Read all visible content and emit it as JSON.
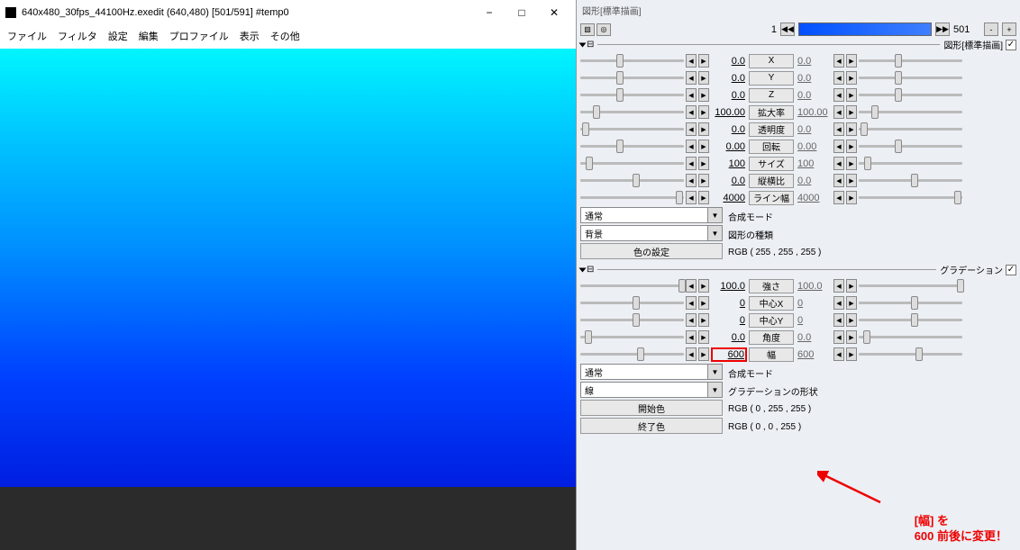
{
  "window": {
    "title": "640x480_30fps_44100Hz.exedit (640,480)  [501/591]  #temp0",
    "minimize": "−",
    "maximize": "□",
    "close": "✕"
  },
  "menu": {
    "file": "ファイル",
    "filter": "フィルタ",
    "settings": "設定",
    "edit": "編集",
    "profile": "プロファイル",
    "display": "表示",
    "other": "その他"
  },
  "panel": {
    "title": "図形[標準描画]"
  },
  "timeline": {
    "cur": "1",
    "end": "501",
    "minus": "-",
    "plus": "+"
  },
  "section1": {
    "name": "図形[標準描画]",
    "handle": "⊟",
    "params": [
      {
        "label": "X",
        "v1": "0.0",
        "v2": "0.0",
        "t1": 35,
        "t2": 35
      },
      {
        "label": "Y",
        "v1": "0.0",
        "v2": "0.0",
        "t1": 35,
        "t2": 35
      },
      {
        "label": "Z",
        "v1": "0.0",
        "v2": "0.0",
        "t1": 35,
        "t2": 35
      },
      {
        "label": "拡大率",
        "v1": "100.00",
        "v2": "100.00",
        "t1": 12,
        "t2": 12
      },
      {
        "label": "透明度",
        "v1": "0.0",
        "v2": "0.0",
        "t1": 2,
        "t2": 2
      },
      {
        "label": "回転",
        "v1": "0.00",
        "v2": "0.00",
        "t1": 35,
        "t2": 35
      },
      {
        "label": "サイズ",
        "v1": "100",
        "v2": "100",
        "t1": 5,
        "t2": 5
      },
      {
        "label": "縦横比",
        "v1": "0.0",
        "v2": "0.0",
        "t1": 50,
        "t2": 50
      },
      {
        "label": "ライン幅",
        "v1": "4000",
        "v2": "4000",
        "t1": 92,
        "t2": 92
      }
    ],
    "blend_mode": "通常",
    "blend_label": "合成モード",
    "shape_type": "背景",
    "shape_label": "図形の種類",
    "color_btn": "色の設定",
    "rgb": "RGB ( 255 , 255 , 255 )"
  },
  "section2": {
    "name": "グラデーション",
    "handle": "⊟",
    "params": [
      {
        "label": "強さ",
        "v1": "100.0",
        "v2": "100.0",
        "t1": 95,
        "t2": 95,
        "hl": false
      },
      {
        "label": "中心X",
        "v1": "0",
        "v2": "0",
        "t1": 50,
        "t2": 50,
        "hl": false
      },
      {
        "label": "中心Y",
        "v1": "0",
        "v2": "0",
        "t1": 50,
        "t2": 50,
        "hl": false
      },
      {
        "label": "角度",
        "v1": "0.0",
        "v2": "0.0",
        "t1": 4,
        "t2": 4,
        "hl": false
      },
      {
        "label": "幅",
        "v1": "600",
        "v2": "600",
        "t1": 55,
        "t2": 55,
        "hl": true
      }
    ],
    "blend_mode": "通常",
    "blend_label": "合成モード",
    "grad_shape": "線",
    "grad_label": "グラデーションの形状",
    "start_color": "開始色",
    "start_rgb": "RGB ( 0 , 255 , 255 )",
    "end_color": "終了色",
    "end_rgb": "RGB ( 0 , 0 , 255 )"
  },
  "annotation": {
    "line1": "[幅] を",
    "line2": "600 前後に変更！"
  },
  "glyphs": {
    "left": "◀",
    "right": "▶",
    "fastl": "◀◀",
    "fastr": "▶▶",
    "check": "✓"
  }
}
